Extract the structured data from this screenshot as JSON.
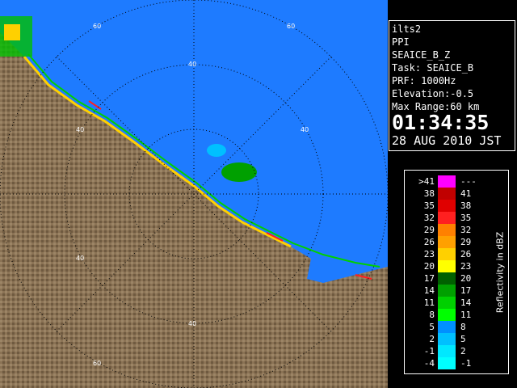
{
  "station": "ilts2",
  "product": "PPI",
  "field": "SEAICE_B_Z",
  "task": "Task: SEAICE_B",
  "prf": "PRF: 1000Hz",
  "elevation": "Elevation:-0.5",
  "max_range": "Max Range:60 km",
  "time": "01:34:35",
  "date": "28 AUG 2010 JST",
  "range_labels": [
    "60",
    "40",
    "40",
    "60",
    "40",
    "40",
    "40",
    "60"
  ],
  "legend": {
    "title": "Reflectivity in dBZ",
    "rows": [
      {
        "low": ">41",
        "high": "---",
        "color": "#ff00ff"
      },
      {
        "low": "38",
        "high": "41",
        "color": "#c00000"
      },
      {
        "low": "35",
        "high": "38",
        "color": "#e00000"
      },
      {
        "low": "32",
        "high": "35",
        "color": "#ff2020"
      },
      {
        "low": "29",
        "high": "32",
        "color": "#ff8000"
      },
      {
        "low": "26",
        "high": "29",
        "color": "#ffa000"
      },
      {
        "low": "23",
        "high": "26",
        "color": "#ffd000"
      },
      {
        "low": "20",
        "high": "23",
        "color": "#ffff00"
      },
      {
        "low": "17",
        "high": "20",
        "color": "#006000"
      },
      {
        "low": "14",
        "high": "17",
        "color": "#00a000"
      },
      {
        "low": "11",
        "high": "14",
        "color": "#00d000"
      },
      {
        "low": "8",
        "high": "11",
        "color": "#00ff00"
      },
      {
        "low": "5",
        "high": "8",
        "color": "#0090ff"
      },
      {
        "low": "2",
        "high": "5",
        "color": "#00c0ff"
      },
      {
        "low": "-1",
        "high": "2",
        "color": "#00e8ff"
      },
      {
        "low": "-4",
        "high": "-1",
        "color": "#00ffff"
      }
    ]
  },
  "colors": {
    "sea": "#1e7bff",
    "land": "#8b7355",
    "rings": "#000000",
    "text": "#ffffff"
  }
}
